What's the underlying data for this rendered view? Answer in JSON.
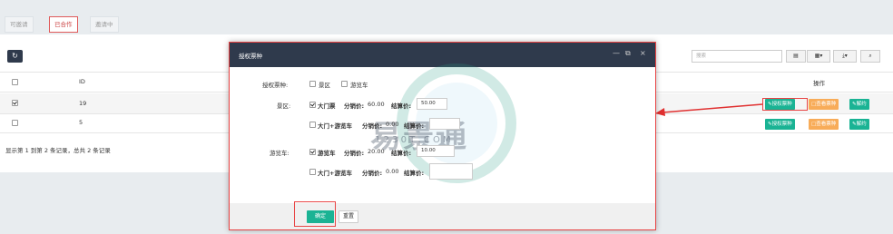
{
  "tabs": [
    {
      "label": "可邀请"
    },
    {
      "label": "已合作"
    },
    {
      "label": "邀请中"
    }
  ],
  "toolbar": {
    "refresh_icon": "refresh-icon",
    "search_placeholder": "搜索",
    "columns_icon": "columns-icon",
    "grid_icon": "grid-icon",
    "export_icon": "export-icon",
    "search_button_icon": "search-icon"
  },
  "table": {
    "headers": {
      "id": "ID",
      "actions": "操作"
    },
    "rows": [
      {
        "id": "19",
        "checked": true,
        "buttons": [
          "授权票种",
          "查看票种",
          "解约"
        ]
      },
      {
        "id": "5",
        "checked": false,
        "buttons": [
          "授权票种",
          "查看票种",
          "解约"
        ]
      }
    ],
    "footer": "显示第 1 到第 2 条记录，总共 2 条记录"
  },
  "modal": {
    "title": "授权票种",
    "ctrl_min": "—",
    "ctrl_restore": "⧉",
    "ctrl_close": "×",
    "type_label": "授权票种:",
    "type_options": [
      {
        "label": "景区",
        "checked": false
      },
      {
        "label": "游览车",
        "checked": false
      }
    ],
    "scenic_label": "景区:",
    "scenic_items": [
      {
        "checked": true,
        "name": "大门票",
        "dist_label": "分销价:",
        "dist_value": "60.00",
        "settle_label": "结算价:",
        "settle_value": "50.00"
      },
      {
        "checked": false,
        "name": "大门+游览车",
        "dist_label": "分销价:",
        "dist_value": "0.00",
        "settle_label": "结算价:",
        "settle_value": ""
      }
    ],
    "bus_label": "游览车:",
    "bus_items": [
      {
        "checked": true,
        "name": "游览车",
        "dist_label": "分销价:",
        "dist_value": "20.00",
        "settle_label": "结算价:",
        "settle_value": "10.00"
      },
      {
        "checked": false,
        "name": "大门+游览车",
        "dist_label": "分销价:",
        "dist_value": "0.00",
        "settle_label": "结算价:",
        "settle_value": ""
      }
    ],
    "confirm": "确定",
    "reset": "重置"
  },
  "watermark": {
    "brand": "易景通",
    "domain": "1 2 3 0 T . C O M"
  },
  "colors": {
    "header_dark": "#2f3a4c",
    "green": "#1ab394",
    "orange": "#f8ac59",
    "highlight": "#e84444"
  }
}
